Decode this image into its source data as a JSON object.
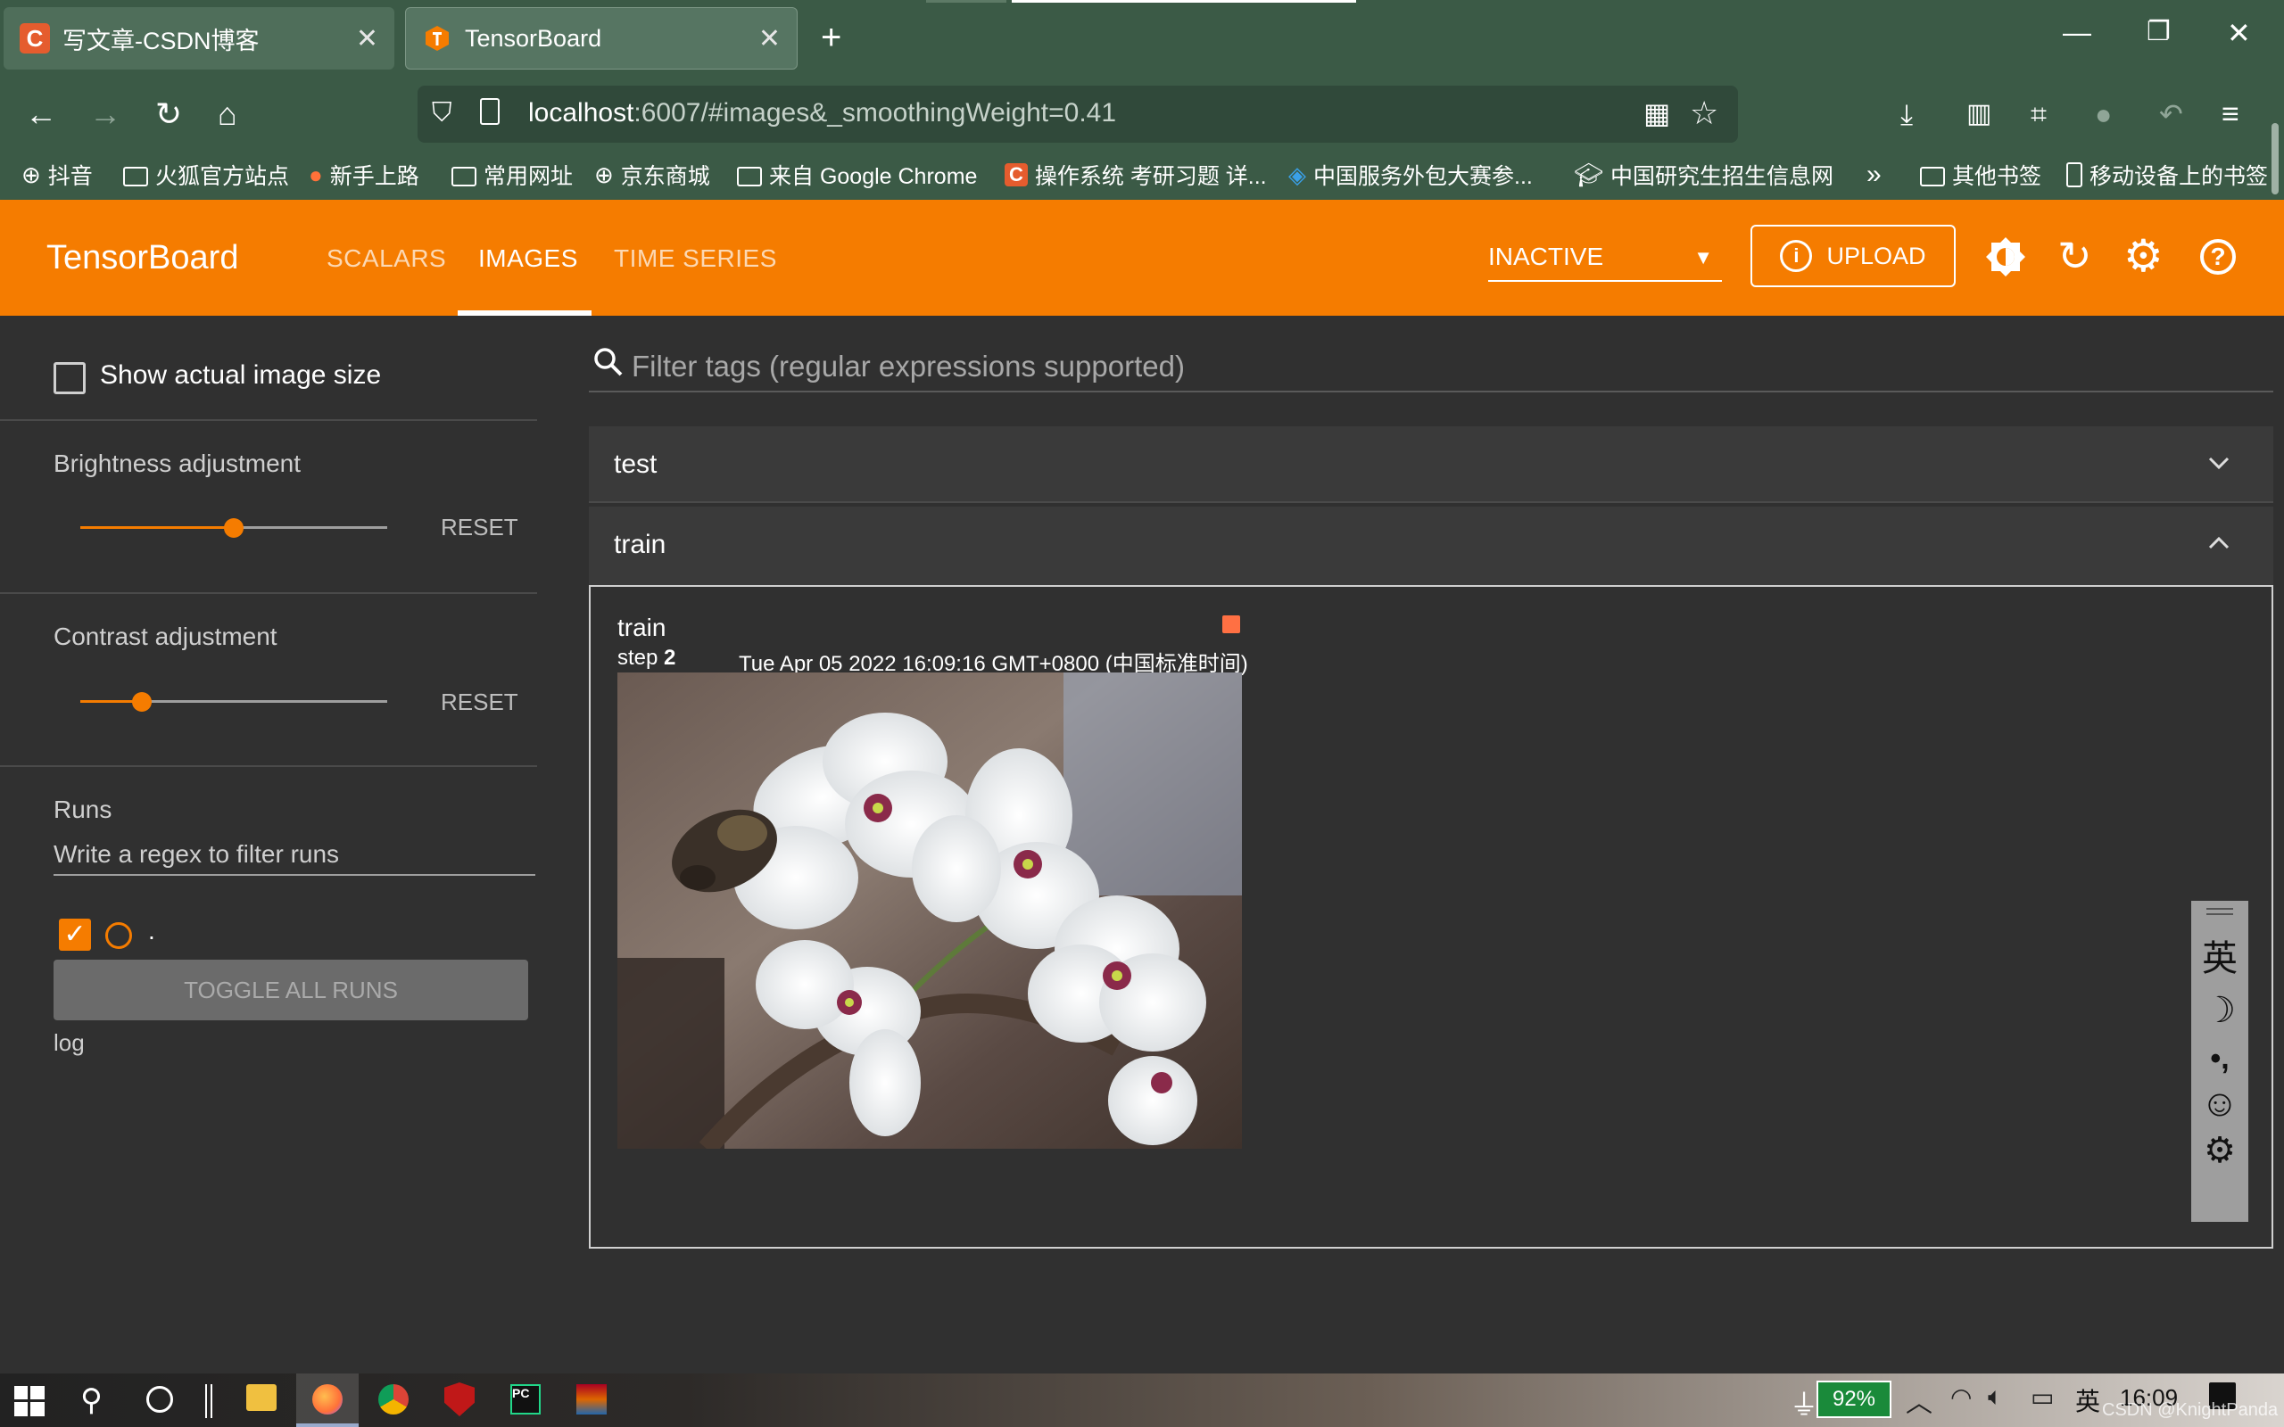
{
  "browser": {
    "tabs": [
      {
        "fav_letter": "C",
        "title": "写文章-CSDN博客"
      },
      {
        "fav_letter": "",
        "title": "TensorBoard"
      }
    ],
    "url_host": "localhost",
    "url_rest": ":6007/#images&_smoothingWeight=0.41",
    "bookmarks": [
      "抖音",
      "火狐官方站点",
      "新手上路",
      "常用网址",
      "京东商城",
      "来自 Google Chrome",
      "操作系统 考研习题 详...",
      "中国服务外包大赛参...",
      "中国研究生招生信息网",
      "其他书签",
      "移动设备上的书签"
    ]
  },
  "toolbar": {
    "title": "TensorBoard",
    "tabs": [
      "SCALARS",
      "IMAGES",
      "TIME SERIES"
    ],
    "active_tab": "IMAGES",
    "run_state": "INACTIVE",
    "upload_label": "UPLOAD",
    "accent_color": "#f57c00"
  },
  "sidebar": {
    "show_actual_size_label": "Show actual image size",
    "show_actual_size_checked": false,
    "brightness_label": "Brightness adjustment",
    "brightness_value": 0.5,
    "contrast_label": "Contrast adjustment",
    "contrast_value": 0.2,
    "reset_label": "RESET",
    "runs_label": "Runs",
    "runs_filter_placeholder": "Write a regex to filter runs",
    "run_name": ".",
    "run_checked": true,
    "toggle_all_label": "TOGGLE ALL RUNS",
    "logdir": "log"
  },
  "main": {
    "filter_placeholder": "Filter tags (regular expressions supported)",
    "groups": [
      {
        "name": "test",
        "expanded": false
      },
      {
        "name": "train",
        "expanded": true
      }
    ],
    "image_card": {
      "tag": "train",
      "step_label": "step",
      "step_value": "2",
      "timestamp": "Tue Apr 05 2022 16:09:16 GMT+0800 (中国标准时间)"
    }
  },
  "ime_toolbar": [
    "英",
    "☽",
    "•,",
    "☺",
    "⚙"
  ],
  "taskbar": {
    "battery": "92%",
    "ime": "英",
    "clock": "16:09",
    "watermark": "CSDN @KnightPanda"
  }
}
